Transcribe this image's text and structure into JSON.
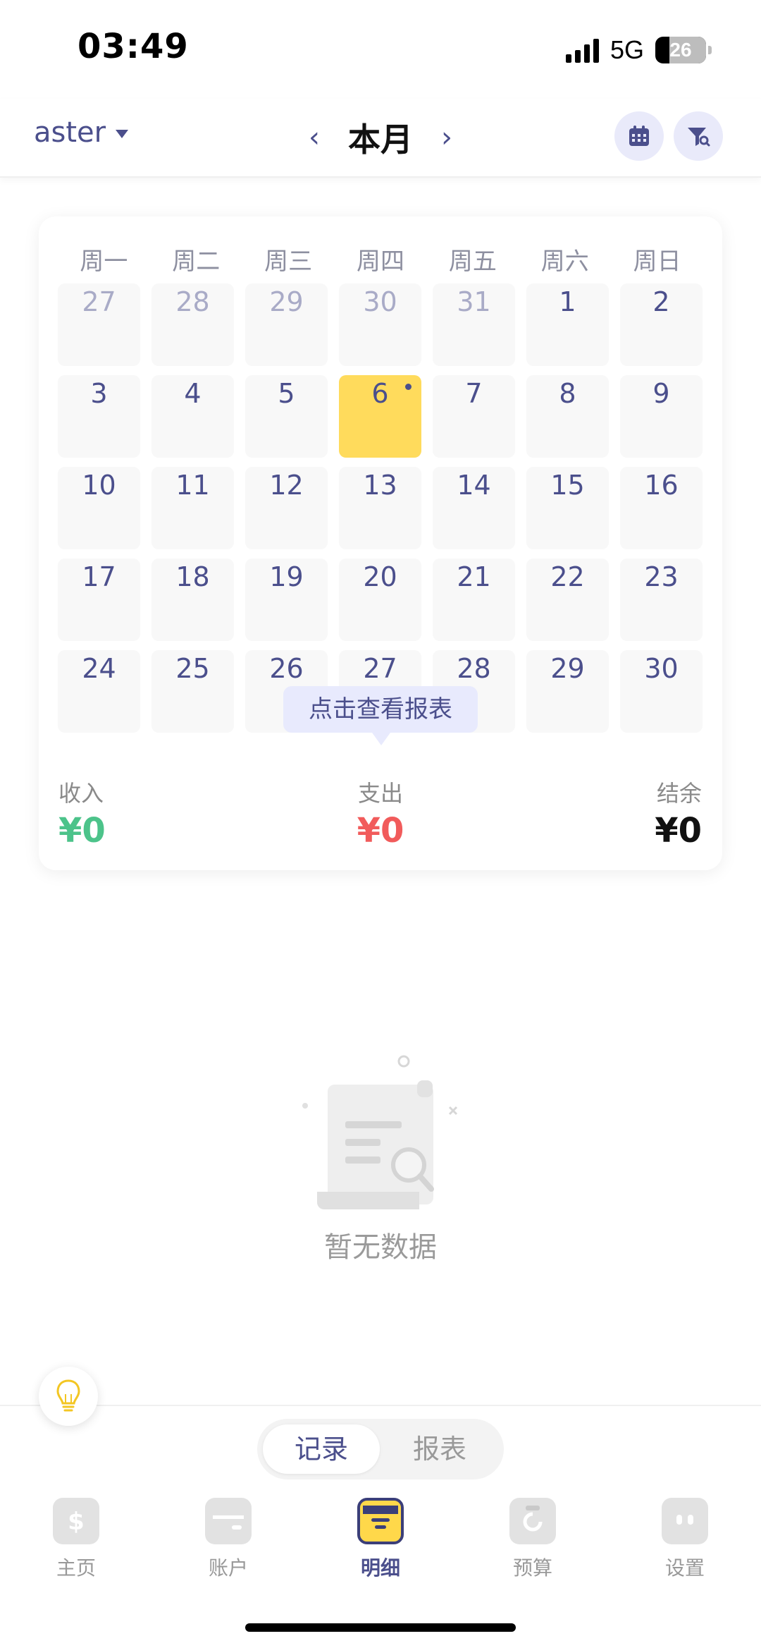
{
  "status_bar": {
    "time": "03:49",
    "network": "5G",
    "battery": "26"
  },
  "header": {
    "book_name": "aster",
    "month_title": "本月",
    "prev_label": "‹",
    "next_label": "›"
  },
  "calendar": {
    "weekdays": [
      "周一",
      "周二",
      "周三",
      "周四",
      "周五",
      "周六",
      "周日"
    ],
    "weeks": [
      [
        "27",
        "28",
        "29",
        "30",
        "31",
        "1",
        "2"
      ],
      [
        "3",
        "4",
        "5",
        "6",
        "7",
        "8",
        "9"
      ],
      [
        "10",
        "11",
        "12",
        "13",
        "14",
        "15",
        "16"
      ],
      [
        "17",
        "18",
        "19",
        "20",
        "21",
        "22",
        "23"
      ],
      [
        "24",
        "25",
        "26",
        "27",
        "28",
        "29",
        "30"
      ]
    ],
    "prev_month_days": 5,
    "today": "6",
    "tooltip": "点击查看报表"
  },
  "summary": {
    "income_label": "收入",
    "income_value": "¥0",
    "expense_label": "支出",
    "expense_value": "¥0",
    "balance_label": "结余",
    "balance_value": "¥0"
  },
  "empty_state": {
    "text": "暂无数据"
  },
  "segment": {
    "active": "记录",
    "inactive": "报表"
  },
  "tabs": [
    {
      "label": "主页",
      "icon": "dollar-card-icon"
    },
    {
      "label": "账户",
      "icon": "wallet-icon"
    },
    {
      "label": "明细",
      "icon": "calendar-list-icon"
    },
    {
      "label": "预算",
      "icon": "budget-clipboard-icon"
    },
    {
      "label": "设置",
      "icon": "robot-face-icon"
    }
  ],
  "colors": {
    "accent": "#4b4f8c",
    "today": "#ffdb5c",
    "income": "#4cc38a",
    "expense": "#f15b5b"
  }
}
